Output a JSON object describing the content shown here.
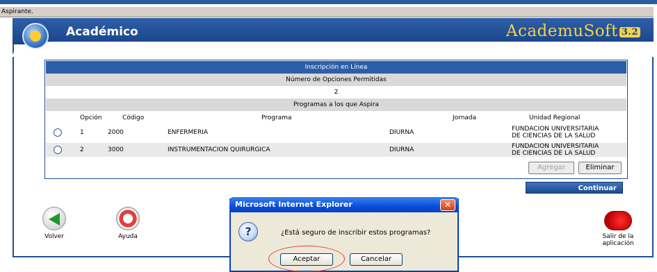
{
  "window": {
    "label": "Aspirante."
  },
  "header": {
    "title": "Académico",
    "brand": "AcademuSoft",
    "brand_version": "3.2"
  },
  "panel": {
    "title": "Inscripción en Línea",
    "options_label": "Número de Opciones Permitidas",
    "options_value": "2",
    "programs_label": "Programas a los que Aspira",
    "columns": {
      "opcion": "Opción",
      "codigo": "Código",
      "programa": "Programa",
      "jornada": "Jornada",
      "unidad": "Unidad Regional"
    },
    "rows": [
      {
        "opcion": "1",
        "codigo": "2000",
        "programa": "ENFERMERIA",
        "jornada": "DIURNA",
        "unidad_l1": "FUNDACION UNIVERSITARIA",
        "unidad_l2": "DE CIENCIAS DE LA SALUD"
      },
      {
        "opcion": "2",
        "codigo": "3000",
        "programa": "INSTRUMENTACION QUIRURGICA",
        "jornada": "DIURNA",
        "unidad_l1": "FUNDACION UNIVERSITARIA",
        "unidad_l2": "DE CIENCIAS DE LA SALUD"
      }
    ],
    "agregar_label": "Agregar",
    "eliminar_label": "Eliminar"
  },
  "continuar_label": "Continuar",
  "nav": {
    "volver": "Volver",
    "ayuda": "Ayuda",
    "salir_l1": "Salir de la",
    "salir_l2": "aplicación"
  },
  "dialog": {
    "title": "Microsoft Internet Explorer",
    "close": "✕",
    "icon": "?",
    "message": "¿Está seguro de inscribir estos programas?",
    "accept": "Aceptar",
    "cancel": "Cancelar"
  }
}
